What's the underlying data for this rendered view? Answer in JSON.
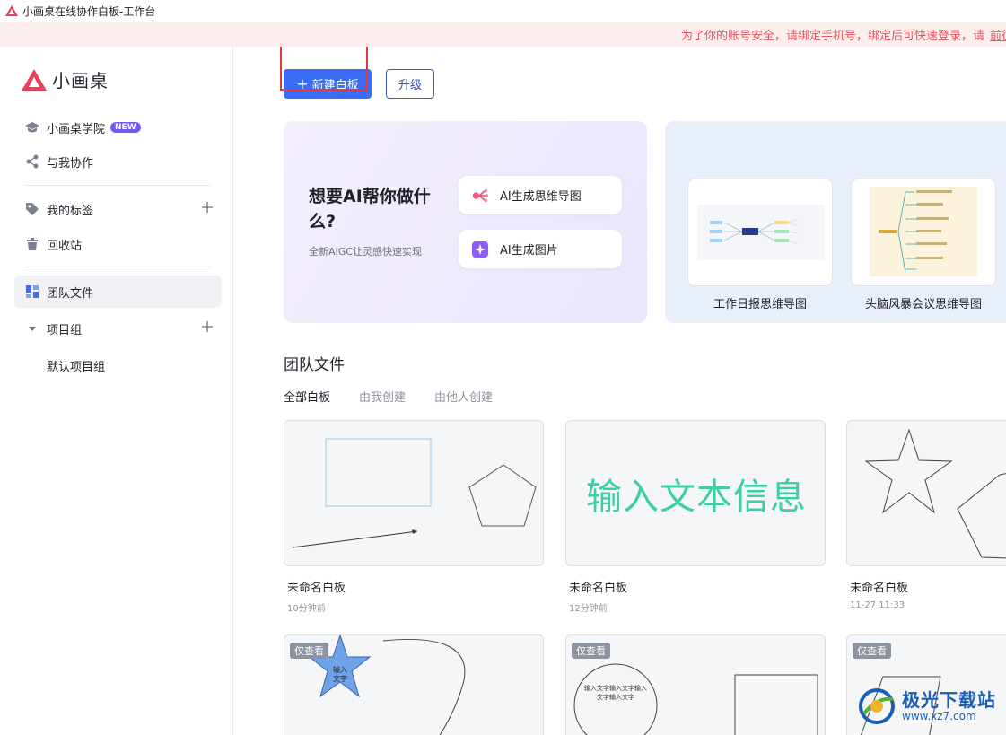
{
  "window": {
    "title": "小画桌在线协作白板-工作台"
  },
  "banner": {
    "text": "为了你的账号安全，请绑定手机号，绑定后可快速登录，请",
    "link": "前往"
  },
  "sidebar": {
    "brand": "小画桌",
    "academy": {
      "label": "小画桌学院",
      "badge": "NEW"
    },
    "collab": "与我协作",
    "tags": "我的标签",
    "trash": "回收站",
    "team_files": "团队文件",
    "project_group": "项目组",
    "default_group": "默认项目组"
  },
  "toolbar": {
    "new_label": "新建白板",
    "upgrade_label": "升级"
  },
  "ai_card": {
    "title": "想要AI帮你做什么?",
    "subtitle": "全新AIGC让灵感快速实现",
    "mindmap_label": "AI生成思维导图",
    "image_label": "AI生成图片"
  },
  "templates": [
    {
      "label": "工作日报思维导图"
    },
    {
      "label": "头脑风暴会议思维导图"
    }
  ],
  "team_section": {
    "title": "团队文件",
    "tabs": [
      "全部白板",
      "由我创建",
      "由他人创建"
    ]
  },
  "files": [
    {
      "name": "未命名白板",
      "time": "10分钟前"
    },
    {
      "name": "未命名白板",
      "time": "12分钟前",
      "preview_text": "输入文本信息"
    },
    {
      "name": "未命名白板",
      "time": "11-27 11:33"
    }
  ],
  "readonly_cards": [
    {
      "badge": "仅查看",
      "star_text": "输入\n文字"
    },
    {
      "badge": "仅查看",
      "circle_text": "输入文字输入文字输入文字输入文字"
    },
    {
      "badge": "仅查看"
    }
  ],
  "watermark": {
    "text": "极光下载站",
    "url": "www.xz7.com"
  },
  "colors": {
    "primary": "#3b6cf5",
    "brand_red": "#e8415a",
    "banner_text": "#e2545f",
    "teal_text": "#3ccfa5"
  }
}
